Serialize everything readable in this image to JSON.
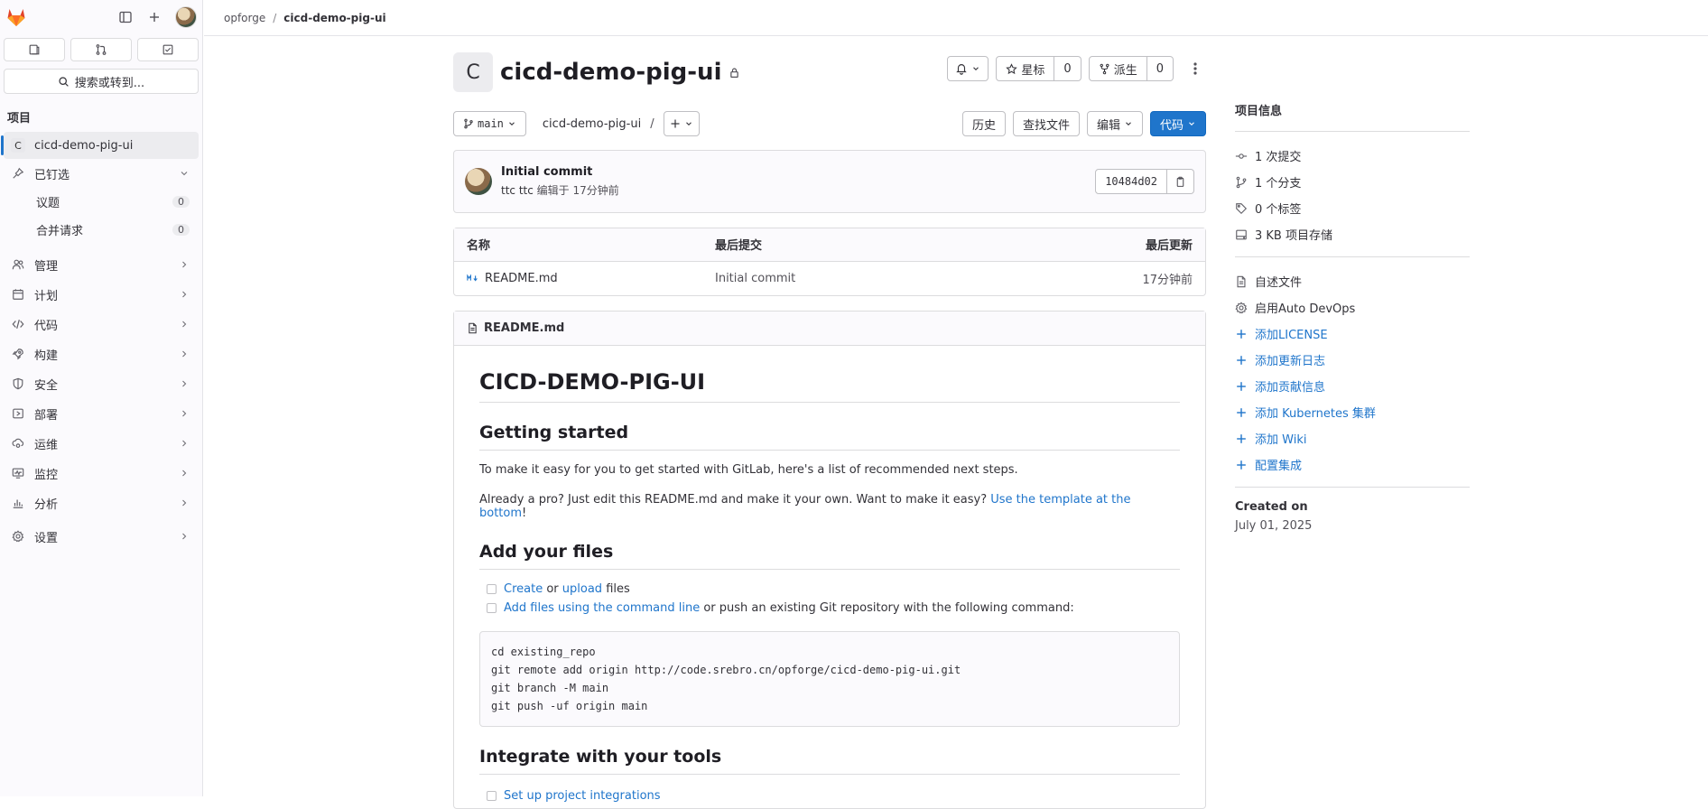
{
  "sidebar": {
    "search_label": "搜索或转到...",
    "section_title": "项目",
    "project_item": {
      "avatar_letter": "C",
      "label": "cicd-demo-pig-ui"
    },
    "pinned": {
      "label": "已钉选",
      "children": [
        {
          "label": "议题",
          "count": "0"
        },
        {
          "label": "合并请求",
          "count": "0"
        }
      ]
    },
    "nav": [
      {
        "label": "管理",
        "icon": "users-icon"
      },
      {
        "label": "计划",
        "icon": "calendar-icon"
      },
      {
        "label": "代码",
        "icon": "code-icon"
      },
      {
        "label": "构建",
        "icon": "rocket-icon"
      },
      {
        "label": "安全",
        "icon": "shield-icon"
      },
      {
        "label": "部署",
        "icon": "deploy-icon"
      },
      {
        "label": "运维",
        "icon": "cloud-gear-icon"
      },
      {
        "label": "监控",
        "icon": "monitor-icon"
      },
      {
        "label": "分析",
        "icon": "chart-icon"
      }
    ],
    "settings_label": "设置"
  },
  "breadcrumb": {
    "group": "opforge",
    "separator": "/",
    "project": "cicd-demo-pig-ui"
  },
  "project": {
    "avatar_letter": "C",
    "name": "cicd-demo-pig-ui",
    "star_label": "星标",
    "star_count": "0",
    "fork_label": "派生",
    "fork_count": "0"
  },
  "repo": {
    "branch": "main",
    "path": "cicd-demo-pig-ui",
    "path_sep": "/",
    "history_label": "历史",
    "find_file_label": "查找文件",
    "edit_label": "编辑",
    "code_label": "代码"
  },
  "commit": {
    "title": "Initial commit",
    "author": "ttc ttc",
    "meta": "编辑于 17分钟前",
    "sha": "10484d02"
  },
  "files": {
    "headers": [
      "名称",
      "最后提交",
      "最后更新"
    ],
    "rows": [
      {
        "name": "README.md",
        "last_commit": "Initial commit",
        "updated": "17分钟前"
      }
    ]
  },
  "readme": {
    "filename": "README.md",
    "h1": "CICD-DEMO-PIG-UI",
    "h2_getting_started": "Getting started",
    "p1": "To make it easy for you to get started with GitLab, here's a list of recommended next steps.",
    "p2_prefix": "Already a pro? Just edit this README.md and make it your own. Want to make it easy? ",
    "p2_link": "Use the template at the bottom",
    "p2_suffix": "!",
    "h2_add_files": "Add your files",
    "task1_create": "Create",
    "task1_or": " or ",
    "task1_upload": "upload",
    "task1_suffix": " files",
    "task2_link": "Add files using the command line",
    "task2_suffix": " or push an existing Git repository with the following command:",
    "code_lines": [
      "cd existing_repo",
      "git remote add origin http://code.srebro.cn/opforge/cicd-demo-pig-ui.git",
      "git branch -M main",
      "git push -uf origin main"
    ],
    "h2_integrate": "Integrate with your tools",
    "task3_link": "Set up project integrations"
  },
  "aside": {
    "title": "项目信息",
    "stats": [
      {
        "icon": "commit-icon",
        "label": "1 次提交"
      },
      {
        "icon": "branch-icon",
        "label": "1 个分支"
      },
      {
        "icon": "tag-icon",
        "label": "0 个标签"
      },
      {
        "icon": "storage-icon",
        "label": "3 KB 项目存储"
      }
    ],
    "links": [
      {
        "icon": "file-icon",
        "label": "自述文件",
        "link": false
      },
      {
        "icon": "gear-icon",
        "label": "启用Auto DevOps",
        "link": false
      },
      {
        "icon": "plus-icon",
        "label": "添加LICENSE",
        "link": true
      },
      {
        "icon": "plus-icon",
        "label": "添加更新日志",
        "link": true
      },
      {
        "icon": "plus-icon",
        "label": "添加贡献信息",
        "link": true
      },
      {
        "icon": "plus-icon",
        "label": "添加 Kubernetes 集群",
        "link": true
      },
      {
        "icon": "plus-icon",
        "label": "添加 Wiki",
        "link": true
      },
      {
        "icon": "plus-icon",
        "label": "配置集成",
        "link": true
      }
    ],
    "created_label": "Created on",
    "created_value": "July 01, 2025"
  },
  "colors": {
    "accent": "#1f75cb",
    "brand": "#e24329"
  }
}
